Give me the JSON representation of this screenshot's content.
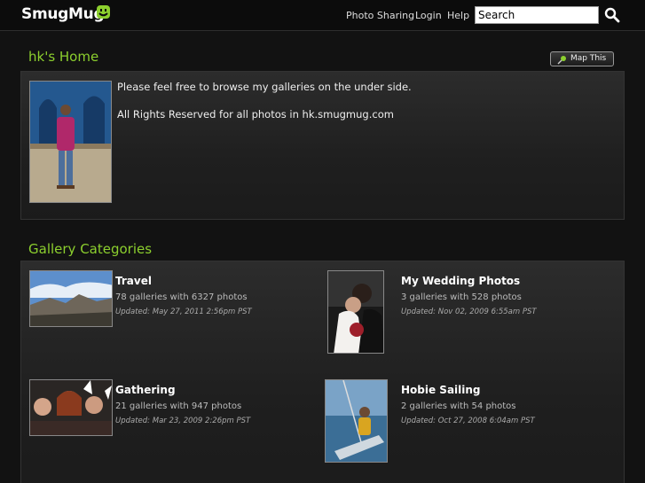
{
  "header": {
    "logo_text": "SmugMug",
    "nav": [
      "Photo Sharing",
      "Login",
      "Help"
    ],
    "search_placeholder": "Search"
  },
  "home": {
    "title": "hk's Home",
    "map_button": "Map This",
    "about_lines": [
      "Please feel free to browse my galleries on the under side.",
      "All Rights Reserved for all photos in hk.smugmug.com"
    ]
  },
  "gallery": {
    "title": "Gallery Categories",
    "categories": [
      {
        "name": "Travel",
        "count": "78 galleries with 6327 photos",
        "updated": "Updated: May 27, 2011 2:56pm PST"
      },
      {
        "name": "My Wedding Photos",
        "count": "3 galleries with 528 photos",
        "updated": "Updated: Nov 02, 2009 6:55am PST"
      },
      {
        "name": "Gathering",
        "count": "21 galleries with 947 photos",
        "updated": "Updated: Mar 23, 2009 2:26pm PST"
      },
      {
        "name": "Hobie Sailing",
        "count": "2 galleries with 54 photos",
        "updated": "Updated: Oct 27, 2008 6:04am PST"
      }
    ]
  },
  "colors": {
    "accent": "#8ccf2e",
    "background": "#121212"
  }
}
